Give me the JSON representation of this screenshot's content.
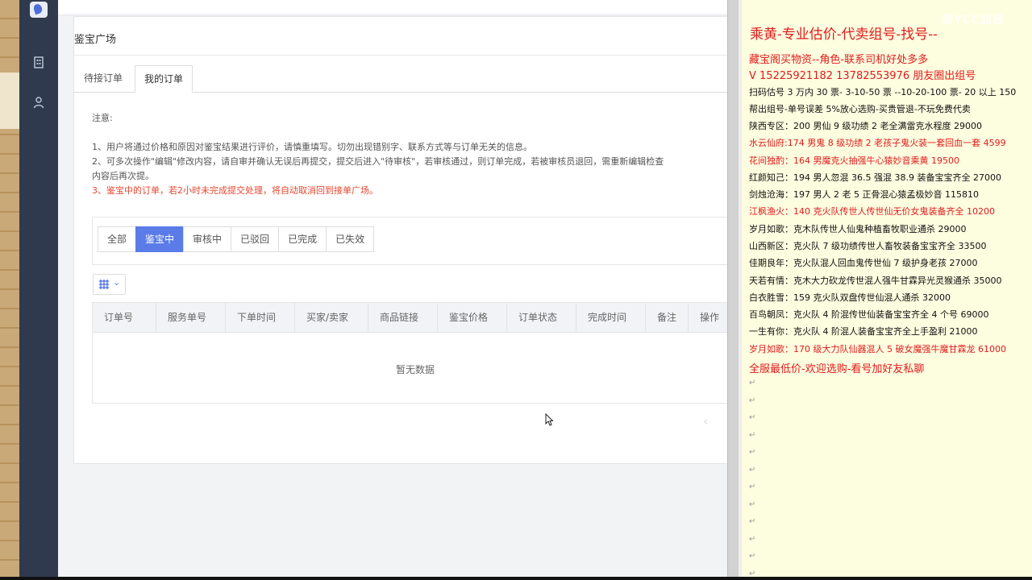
{
  "sidebar": {
    "icons": [
      "logo",
      "building-icon",
      "user-icon"
    ]
  },
  "page": {
    "title": "鉴宝广场",
    "tabs": [
      {
        "label": "待接订单",
        "active": false
      },
      {
        "label": "我的订单",
        "active": true
      }
    ]
  },
  "notes": {
    "heading": "注意:",
    "line1": "1、用户将通过价格和原因对鉴宝结果进行评价，请慎重填写。切勿出现错别字、联系方式等与订单无关的信息。",
    "line2a": "2、可多次操作\"编辑\"修改内容，请自审并确认无误后再提交，提交后进入\"待审核\"，若审核通过，则订单完成，若被审核员退回，需重新编辑检查",
    "line2b": "内容后再次提。",
    "line3": "3、鉴宝中的订单，若2小时未完成提交处理，将自动取消回到接单广场。"
  },
  "filters": [
    "全部",
    "鉴宝中",
    "审核中",
    "已驳回",
    "已完成",
    "已失效"
  ],
  "filter_active": "鉴宝中",
  "table": {
    "columns": [
      "订单号",
      "服务单号",
      "下单时间",
      "买家/卖家",
      "商品链接",
      "鉴宝价格",
      "订单状态",
      "完成时间",
      "备注",
      "操作"
    ],
    "empty_text": "暂无数据"
  },
  "doc": {
    "heading": "乘黄-专业估价-代卖组号-找号--",
    "lines": [
      {
        "text": "藏宝阁买物资--角色-联系司机好处多多",
        "style": "red big"
      },
      {
        "text": "V 15225921182   13782553976 朋友圈出组号",
        "style": "red big"
      },
      {
        "text": "扫码估号 3 万内 30 票- 3-10-50 票  --10-20-100 票- 20 以上 150",
        "style": ""
      },
      {
        "text": "帮出组号-单号误差 5%放心选购-买贵管退-不玩免费代卖",
        "style": ""
      },
      {
        "text": "陕西专区：200 男仙 9 级功绩 2 老全满雷克水程度 29000",
        "style": ""
      },
      {
        "text": "水云仙府:174 男鬼 8 级功绩 2 老孩子鬼火装一套回血一套 4599",
        "style": "red"
      },
      {
        "text": "花间独酌：164 男魔克火抽强牛心猿妙音乘黄 19500",
        "style": "red"
      },
      {
        "text": "红颜知己：194 男人忽混 36.5 强混 38.9 装备宝宝齐全 27000",
        "style": ""
      },
      {
        "text": "剑烛沧海：197 男人 2 老 5 正骨混心猿孟极妙音 115810",
        "style": ""
      },
      {
        "text": "江枫渔火：140 克火队传世人传世仙无价女鬼装备齐全 10200",
        "style": "red"
      },
      {
        "text": "岁月如歌：克木队传世人仙鬼种植畜牧职业通杀 29000",
        "style": ""
      },
      {
        "text": "山西新区：克火队 7 级功绩传世人畜牧装备宝宝齐全 33500",
        "style": ""
      },
      {
        "text": "佳期良年：克火队混人回血鬼传世仙 7 级护身老孩 27000",
        "style": ""
      },
      {
        "text": "天若有情：克木大力砍龙传世混人强牛甘霖异光灵猴通杀 35000",
        "style": ""
      },
      {
        "text": "白衣胜雪：159 克火队双盘传世仙混人通杀 32000",
        "style": ""
      },
      {
        "text": "百鸟朝凤：克火队 4 阶混传世仙装备宝宝齐全 4 个号 69000",
        "style": ""
      },
      {
        "text": "一生有你：克火队 4 阶混人装备宝宝齐全上手盈利 21000",
        "style": ""
      },
      {
        "text": "岁月如歌：170 级大力队仙器混人 5 破女魔强牛魔甘霖龙 61000",
        "style": "red"
      },
      {
        "text": "全服最低价-欢迎选购-看号加好友私聊",
        "style": "red big"
      }
    ],
    "para_mark": "↵"
  },
  "watermark": "看YCC面板"
}
